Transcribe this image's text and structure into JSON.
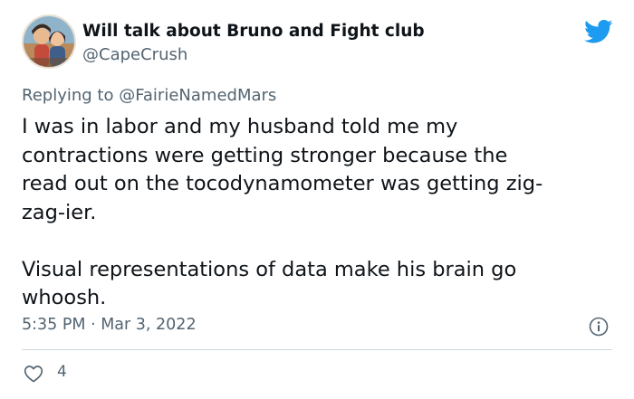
{
  "author": {
    "display_name": "Will talk about Bruno and Fight club",
    "handle": "@CapeCrush",
    "avatar_icon": "cartoon-couple-avatar"
  },
  "platform_icon": "twitter-bird-icon",
  "reply": {
    "prefix": "Replying to ",
    "mention": "@FairieNamedMars"
  },
  "text_lines": [
    "I was in labor and my husband told me my",
    "contractions were getting stronger because the",
    "read out on the tocodynamometer was getting zig-",
    "zag-ier.",
    "",
    "Visual representations of data make his brain go",
    "whoosh."
  ],
  "timestamp": "5:35 PM · Mar 3, 2022",
  "likes": {
    "count": "4"
  },
  "colors": {
    "text": "#0f1419",
    "secondary": "#536471",
    "brand_blue": "#1d9bf0",
    "divider": "#cfd9de"
  }
}
